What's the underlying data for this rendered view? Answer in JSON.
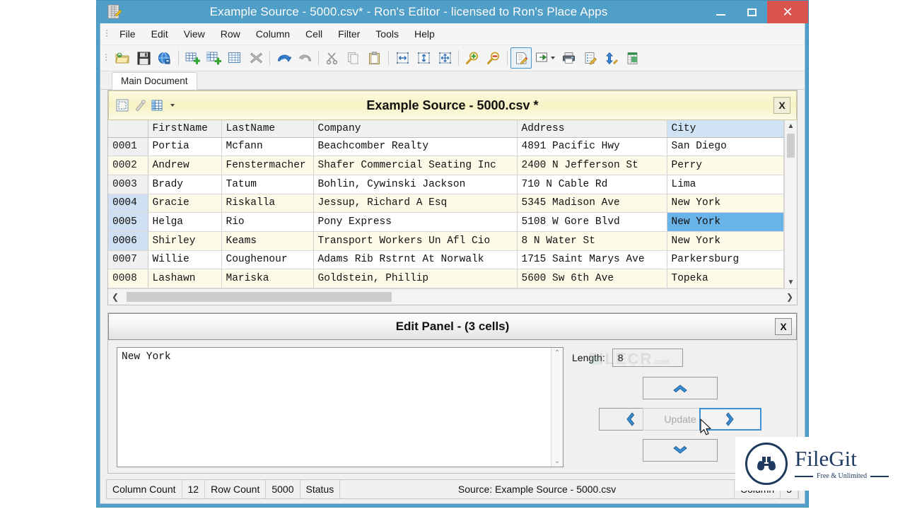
{
  "window": {
    "title": "Example Source - 5000.csv* - Ron's Editor - licensed to Ron's Place Apps",
    "minimize_label": "Minimize",
    "maximize_label": "Maximize",
    "close_label": "✕",
    "titlebar_color": "#4f9fc8",
    "close_color": "#d9534f"
  },
  "menu": {
    "items": [
      {
        "label": "File"
      },
      {
        "label": "Edit"
      },
      {
        "label": "View"
      },
      {
        "label": "Row"
      },
      {
        "label": "Column"
      },
      {
        "label": "Cell"
      },
      {
        "label": "Filter"
      },
      {
        "label": "Tools"
      },
      {
        "label": "Help"
      }
    ]
  },
  "toolbar": {
    "buttons": [
      {
        "icon": "open-folder-icon",
        "tooltip": "Open"
      },
      {
        "icon": "save-disk-icon",
        "tooltip": "Save"
      },
      {
        "icon": "globe-save-icon",
        "tooltip": "Save As Web"
      },
      {
        "sep": true
      },
      {
        "icon": "insert-row-icon",
        "tooltip": "Insert Row"
      },
      {
        "icon": "insert-column-icon",
        "tooltip": "Insert Column"
      },
      {
        "icon": "grid-icon",
        "tooltip": "Grid"
      },
      {
        "icon": "delete-x-icon",
        "tooltip": "Delete"
      },
      {
        "sep": true
      },
      {
        "icon": "undo-arrow-icon",
        "tooltip": "Undo"
      },
      {
        "icon": "redo-arrow-icon",
        "tooltip": "Redo"
      },
      {
        "sep": true
      },
      {
        "icon": "cut-scissors-icon",
        "tooltip": "Cut"
      },
      {
        "icon": "copy-icon",
        "tooltip": "Copy"
      },
      {
        "icon": "paste-clipboard-icon",
        "tooltip": "Paste"
      },
      {
        "sep": true
      },
      {
        "icon": "fit-width-icon",
        "tooltip": "Fit Width"
      },
      {
        "icon": "fit-height-icon",
        "tooltip": "Fit Height"
      },
      {
        "icon": "fit-both-icon",
        "tooltip": "Fit Both"
      },
      {
        "sep": true
      },
      {
        "icon": "zoom-in-icon",
        "tooltip": "Zoom In"
      },
      {
        "icon": "zoom-out-icon",
        "tooltip": "Zoom Out"
      },
      {
        "sep": true
      },
      {
        "icon": "edit-page-icon",
        "tooltip": "Edit Panel",
        "active": true
      },
      {
        "icon": "export-arrow-icon",
        "tooltip": "Export",
        "dropdown": true
      },
      {
        "icon": "print-icon",
        "tooltip": "Print"
      },
      {
        "icon": "edit-list-icon",
        "tooltip": "Edit List"
      },
      {
        "icon": "sort-updown-icon",
        "tooltip": "Sort"
      },
      {
        "icon": "excel-icon",
        "tooltip": "Open in Excel"
      }
    ]
  },
  "tabs": [
    {
      "label": "Main Document",
      "active": true
    }
  ],
  "document_panel": {
    "title": "Example Source - 5000.csv *",
    "close_label": "X",
    "header_icons": [
      {
        "icon": "select-region-icon"
      },
      {
        "icon": "magic-wand-icon"
      },
      {
        "icon": "column-table-icon",
        "dropdown": true
      }
    ],
    "header_bg": "#f7f2c4"
  },
  "grid": {
    "columns": [
      "",
      "FirstName",
      "LastName",
      "Company",
      "Address",
      "City"
    ],
    "selected_column": "City",
    "rows": [
      {
        "num": "0001",
        "selected_rownum": false,
        "cells": [
          "Portia",
          "Mcfann",
          "Beachcomber Realty",
          "4891 Pacific Hwy",
          "San Diego"
        ],
        "city_selected": false
      },
      {
        "num": "0002",
        "selected_rownum": false,
        "cells": [
          "Andrew",
          "Fenstermacher",
          "Shafer Commercial Seating Inc",
          "2400 N Jefferson St",
          "Perry"
        ],
        "city_selected": false
      },
      {
        "num": "0003",
        "selected_rownum": false,
        "cells": [
          "Brady",
          "Tatum",
          "Bohlin, Cywinski Jackson",
          "710 N Cable Rd",
          "Lima"
        ],
        "city_selected": false
      },
      {
        "num": "0004",
        "selected_rownum": true,
        "cells": [
          "Gracie",
          "Riskalla",
          "Jessup, Richard A Esq",
          "5345 Madison Ave",
          "New York"
        ],
        "city_selected": true
      },
      {
        "num": "0005",
        "selected_rownum": true,
        "cells": [
          "Helga",
          "Rio",
          "Pony Express",
          "5108 W Gore Blvd",
          "New York"
        ],
        "city_selected": true
      },
      {
        "num": "0006",
        "selected_rownum": true,
        "cells": [
          "Shirley",
          "Keams",
          "Transport Workers Un Afl Cio",
          "8 N Water St",
          "New York"
        ],
        "city_selected": true
      },
      {
        "num": "0007",
        "selected_rownum": false,
        "cells": [
          "Willie",
          "Coughenour",
          "Adams Rib Rstrnt At Norwalk",
          "1715 Saint Marys Ave",
          "Parkersburg"
        ],
        "city_selected": false
      },
      {
        "num": "0008",
        "selected_rownum": false,
        "cells": [
          "Lashawn",
          "Mariska",
          "Goldstein, Phillip",
          "5600 Sw 6th Ave",
          "Topeka"
        ],
        "city_selected": false
      }
    ],
    "selection_color": "#6ab3e8",
    "alt_row_color": "#fdfbe8"
  },
  "edit_panel": {
    "title": "Edit Panel - (3 cells)",
    "close_label": "X",
    "textarea_value": "New York",
    "length_label": "Length:",
    "length_value": "8",
    "buttons": {
      "up": "▲",
      "down": "▼",
      "left": "◀",
      "right": "▶",
      "update": "Update",
      "update_disabled": true,
      "right_focused": true
    }
  },
  "status_bar": {
    "column_count_label": "Column Count",
    "column_count_value": "12",
    "row_count_label": "Row Count",
    "row_count_value": "5000",
    "status_label": "Status",
    "source_text": "Source: Example Source - 5000.csv",
    "column_label": "Column",
    "column_value": "5"
  },
  "watermarks": {
    "filecr": "FILECR",
    "filecr_dot": ".com",
    "filegit_name": "FileGit",
    "filegit_tagline": "Free & Unlimited"
  }
}
